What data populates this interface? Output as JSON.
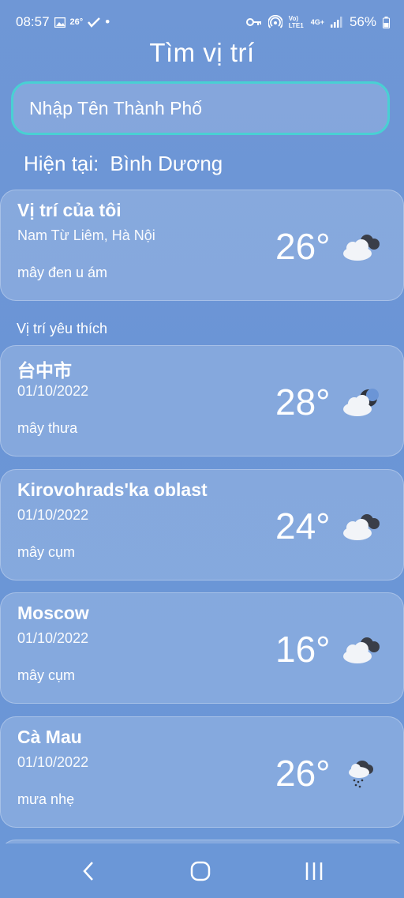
{
  "status_bar": {
    "time": "08:57",
    "temp_badge": "26°",
    "dot": "•",
    "network": "4G+",
    "lte": "Vo) LTE1",
    "battery": "56%"
  },
  "header": {
    "title": "Tìm vị trí"
  },
  "search": {
    "placeholder": "Nhập Tên Thành Phố"
  },
  "current": {
    "label": "Hiện tại:",
    "city": "Bình Dương"
  },
  "my_location": {
    "name": "Vị trí của tôi",
    "sub": "Nam Từ Liêm, Hà Nội",
    "desc": "mây đen u ám",
    "temp": "26°",
    "icon": "cloudy-icon"
  },
  "favorites_label": "Vị trí yêu thích",
  "favorites": [
    {
      "name": "台中市",
      "date": "01/10/2022",
      "desc": "mây thưa",
      "temp": "28°",
      "icon": "partly-cloudy-night-icon"
    },
    {
      "name": "Kirovohrads'ka oblast",
      "date": "01/10/2022",
      "desc": "mây cụm",
      "temp": "24°",
      "icon": "cloudy-icon"
    },
    {
      "name": "Moscow",
      "date": "01/10/2022",
      "desc": "mây cụm",
      "temp": "16°",
      "icon": "cloudy-icon"
    },
    {
      "name": "Cà Mau",
      "date": "01/10/2022",
      "desc": "mưa nhẹ",
      "temp": "26°",
      "icon": "light-rain-icon"
    }
  ],
  "nav": {
    "back": "back-icon",
    "home": "home-icon",
    "recents": "recents-icon"
  }
}
